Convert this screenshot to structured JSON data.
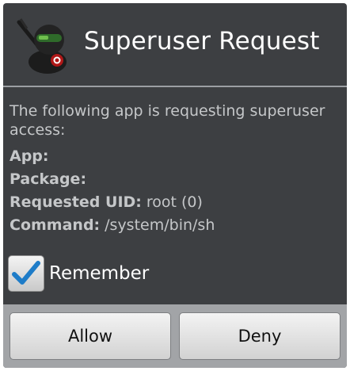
{
  "dialog": {
    "title": "Superuser Request",
    "icon": "superuser-ninja-icon",
    "message": "The following app is requesting superuser access:",
    "fields": [
      {
        "label": "App:",
        "value": ""
      },
      {
        "label": "Package:",
        "value": ""
      },
      {
        "label": "Requested UID:",
        "value": "root (0)"
      },
      {
        "label": "Command:",
        "value": "/system/bin/sh"
      }
    ],
    "remember": {
      "label": "Remember",
      "checked": true
    },
    "buttons": {
      "allow": "Allow",
      "deny": "Deny"
    }
  },
  "colors": {
    "dialog_bg": "#3d3f42",
    "text": "#c5c7c9",
    "title": "#ffffff",
    "button_bar": "#a2a4a7",
    "check_accent": "#1e7cc8"
  }
}
